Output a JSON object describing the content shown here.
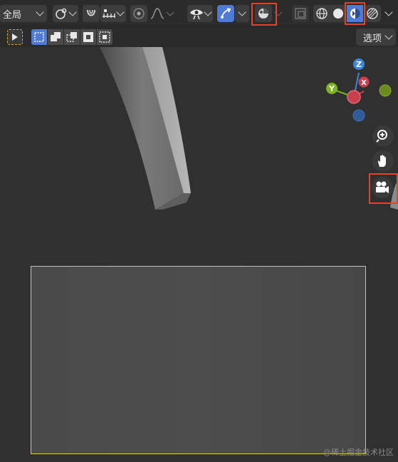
{
  "header": {
    "mode_select": "全局",
    "options_button": "选项"
  },
  "viewport": {
    "gizmo": {
      "z_label": "Z",
      "y_label": "Y",
      "x_label": "X"
    },
    "watermark": "@稀土掘金技术社区"
  },
  "icons": {
    "transform": "transform-pivot-icon",
    "snap": "magnet-icon",
    "proportional": "proportional-edit-icon",
    "visibility": "eye-icon",
    "gizmo_toggle": "gizmo-arrow-icon",
    "overlay": "overlay-icon",
    "xray": "xray-icon",
    "shading_wire": "wireframe-shading-icon",
    "shading_solid": "solid-shading-icon",
    "shading_material": "material-preview-icon",
    "shading_rendered": "rendered-shading-icon",
    "zoom": "zoom-icon",
    "pan": "hand-icon",
    "camera": "camera-icon"
  },
  "colors": {
    "accent_blue": "#4f7bd4",
    "highlight_red": "#e0452c",
    "selection_yellow": "#d4d23e",
    "axis_x": "#c9404f",
    "axis_y": "#7cb61c",
    "axis_z": "#3a86d8"
  }
}
